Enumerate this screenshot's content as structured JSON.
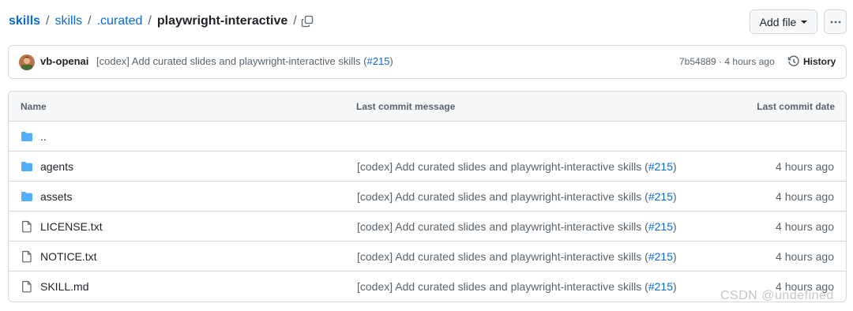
{
  "breadcrumb": {
    "items": [
      "skills",
      "skills",
      ".curated"
    ],
    "current": "playwright-interactive",
    "separator": "/"
  },
  "toolbar": {
    "add_file_label": "Add file",
    "more_label": "···"
  },
  "commit": {
    "author": "vb-openai",
    "message": "[codex] Add curated slides and playwright-interactive skills (",
    "pr": "#215",
    "message_end": ")",
    "meta": "7b54889 · 4 hours ago",
    "history_label": "History"
  },
  "table": {
    "headers": {
      "name": "Name",
      "message": "Last commit message",
      "date": "Last commit date"
    },
    "rows": [
      {
        "type": "folder",
        "name": "..",
        "message": "",
        "pr": "",
        "message_end": "",
        "date": ""
      },
      {
        "type": "folder",
        "name": "agents",
        "message": "[codex] Add curated slides and playwright-interactive skills (",
        "pr": "#215",
        "message_end": ")",
        "date": "4 hours ago"
      },
      {
        "type": "folder",
        "name": "assets",
        "message": "[codex] Add curated slides and playwright-interactive skills (",
        "pr": "#215",
        "message_end": ")",
        "date": "4 hours ago"
      },
      {
        "type": "file",
        "name": "LICENSE.txt",
        "message": "[codex] Add curated slides and playwright-interactive skills (",
        "pr": "#215",
        "message_end": ")",
        "date": "4 hours ago"
      },
      {
        "type": "file",
        "name": "NOTICE.txt",
        "message": "[codex] Add curated slides and playwright-interactive skills (",
        "pr": "#215",
        "message_end": ")",
        "date": "4 hours ago"
      },
      {
        "type": "file",
        "name": "SKILL.md",
        "message": "[codex] Add curated slides and playwright-interactive skills (",
        "pr": "#215",
        "message_end": ")",
        "date": "4 hours ago"
      }
    ]
  },
  "watermark": "CSDN @undefined",
  "icons": {
    "copy": "copy-icon",
    "folder": "folder-icon",
    "file": "file-icon",
    "history": "history-icon"
  },
  "colors": {
    "link": "#0969da",
    "folder": "#54aeff",
    "border": "#d1d9e0",
    "muted": "#59636e"
  }
}
